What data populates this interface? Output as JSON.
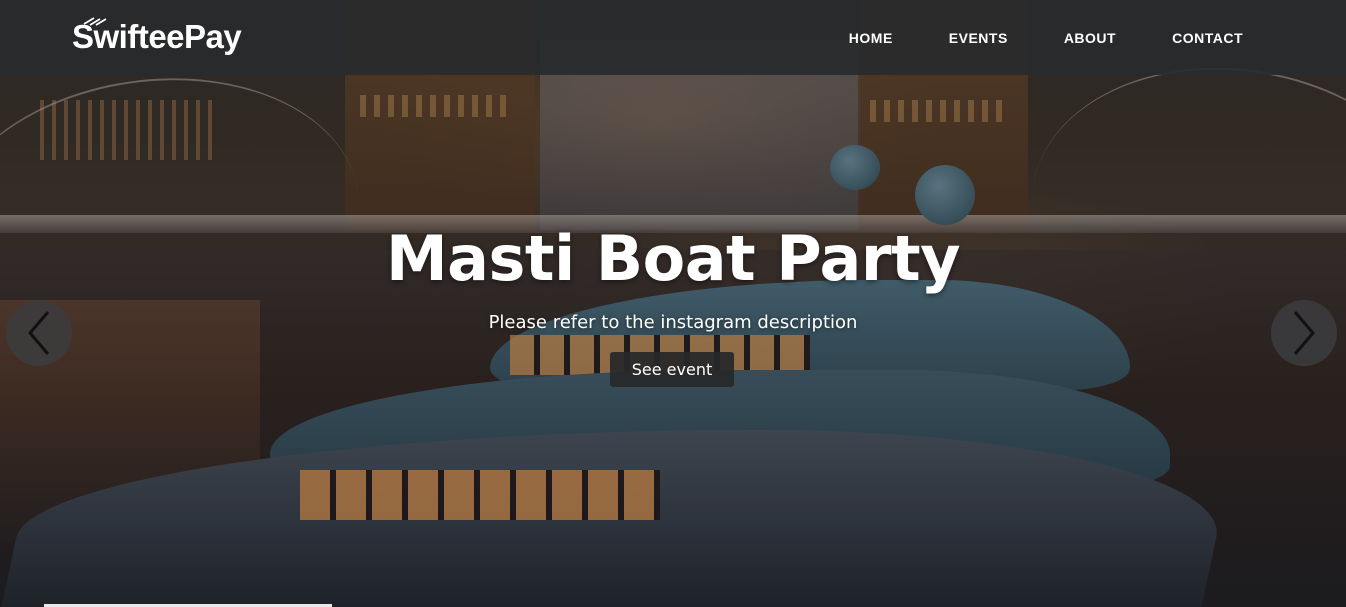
{
  "brand": {
    "name": "SwifteePay"
  },
  "nav": {
    "items": [
      {
        "label": "HOME"
      },
      {
        "label": "EVENTS"
      },
      {
        "label": "ABOUT"
      },
      {
        "label": "CONTACT"
      }
    ]
  },
  "hero": {
    "title": "Masti Boat Party",
    "subtitle": "Please refer to the instagram description",
    "button_label": "See event"
  },
  "carousel": {
    "prev_icon": "chevron-left-icon",
    "next_icon": "chevron-right-icon"
  },
  "colors": {
    "navbar_bg": "#2a2c2e",
    "button_bg": "#26282a",
    "text": "#ffffff"
  }
}
